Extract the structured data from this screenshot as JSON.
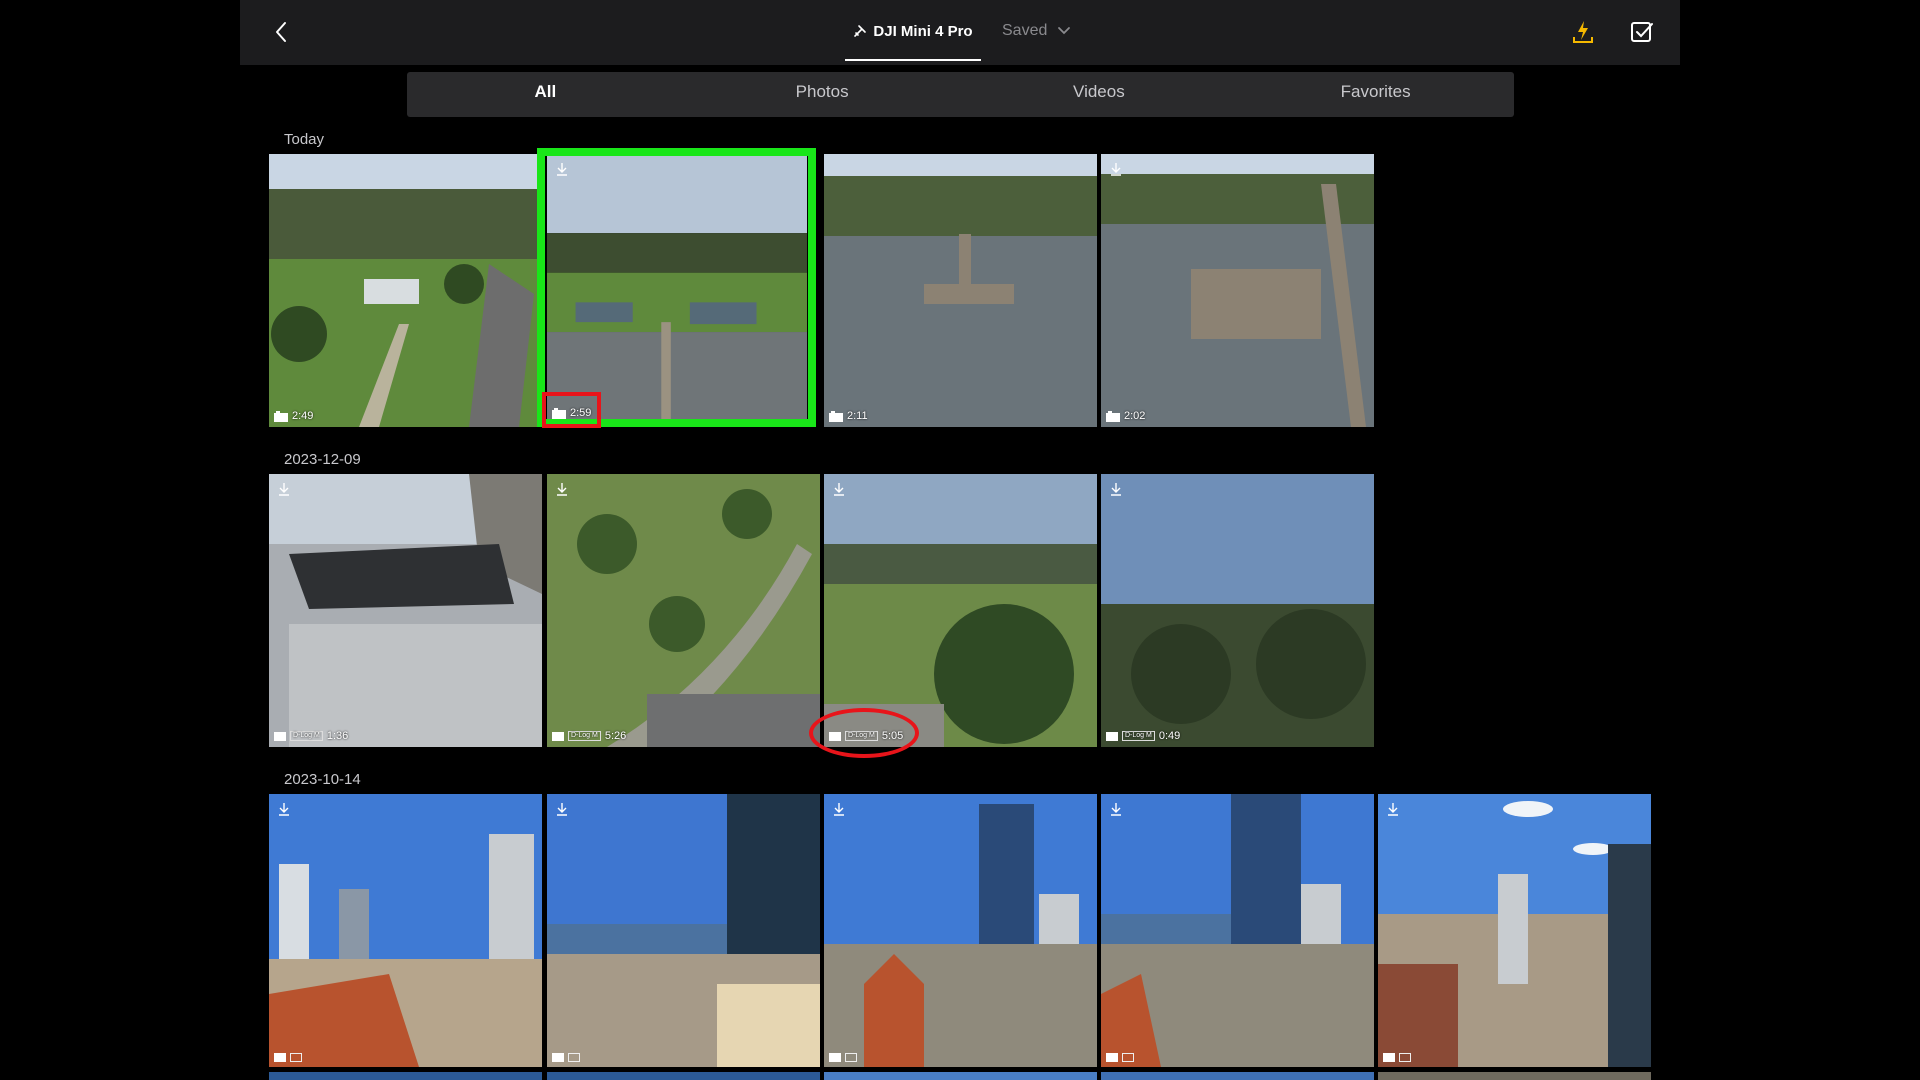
{
  "header": {
    "device_name": "DJI Mini 4 Pro",
    "saved_label": "Saved",
    "back_icon": "chevron-left-icon",
    "flash_download_icon": "flash-download-icon",
    "select_icon": "checkbox-icon",
    "accent_color": "#f5b800"
  },
  "filters": {
    "all": "All",
    "photos": "Photos",
    "videos": "Videos",
    "favorites": "Favorites",
    "active": "All"
  },
  "sections": [
    {
      "date": "Today",
      "items": [
        {
          "duration": "2:49",
          "scene": "park"
        },
        {
          "duration": "2:59",
          "scene": "lake-aerial"
        },
        {
          "duration": "2:11",
          "scene": "dock"
        },
        {
          "duration": "2:02",
          "scene": "pier"
        }
      ]
    },
    {
      "date": "2023-12-09",
      "items": [
        {
          "duration": "1:36",
          "badge": "D-Log M",
          "scene": "car"
        },
        {
          "duration": "5:26",
          "badge": "D-Log M",
          "scene": "field"
        },
        {
          "duration": "5:05",
          "badge": "D-Log M",
          "scene": "trees"
        },
        {
          "duration": "0:49",
          "badge": "D-Log M",
          "scene": "forest"
        }
      ]
    },
    {
      "date": "2023-10-14",
      "items": [
        {
          "scene": "city1"
        },
        {
          "scene": "city2"
        },
        {
          "scene": "city3"
        },
        {
          "scene": "city4"
        },
        {
          "scene": "city5"
        }
      ]
    }
  ],
  "annotations": {
    "highlight_color": "#19e619",
    "marker_color": "#e8141a"
  }
}
